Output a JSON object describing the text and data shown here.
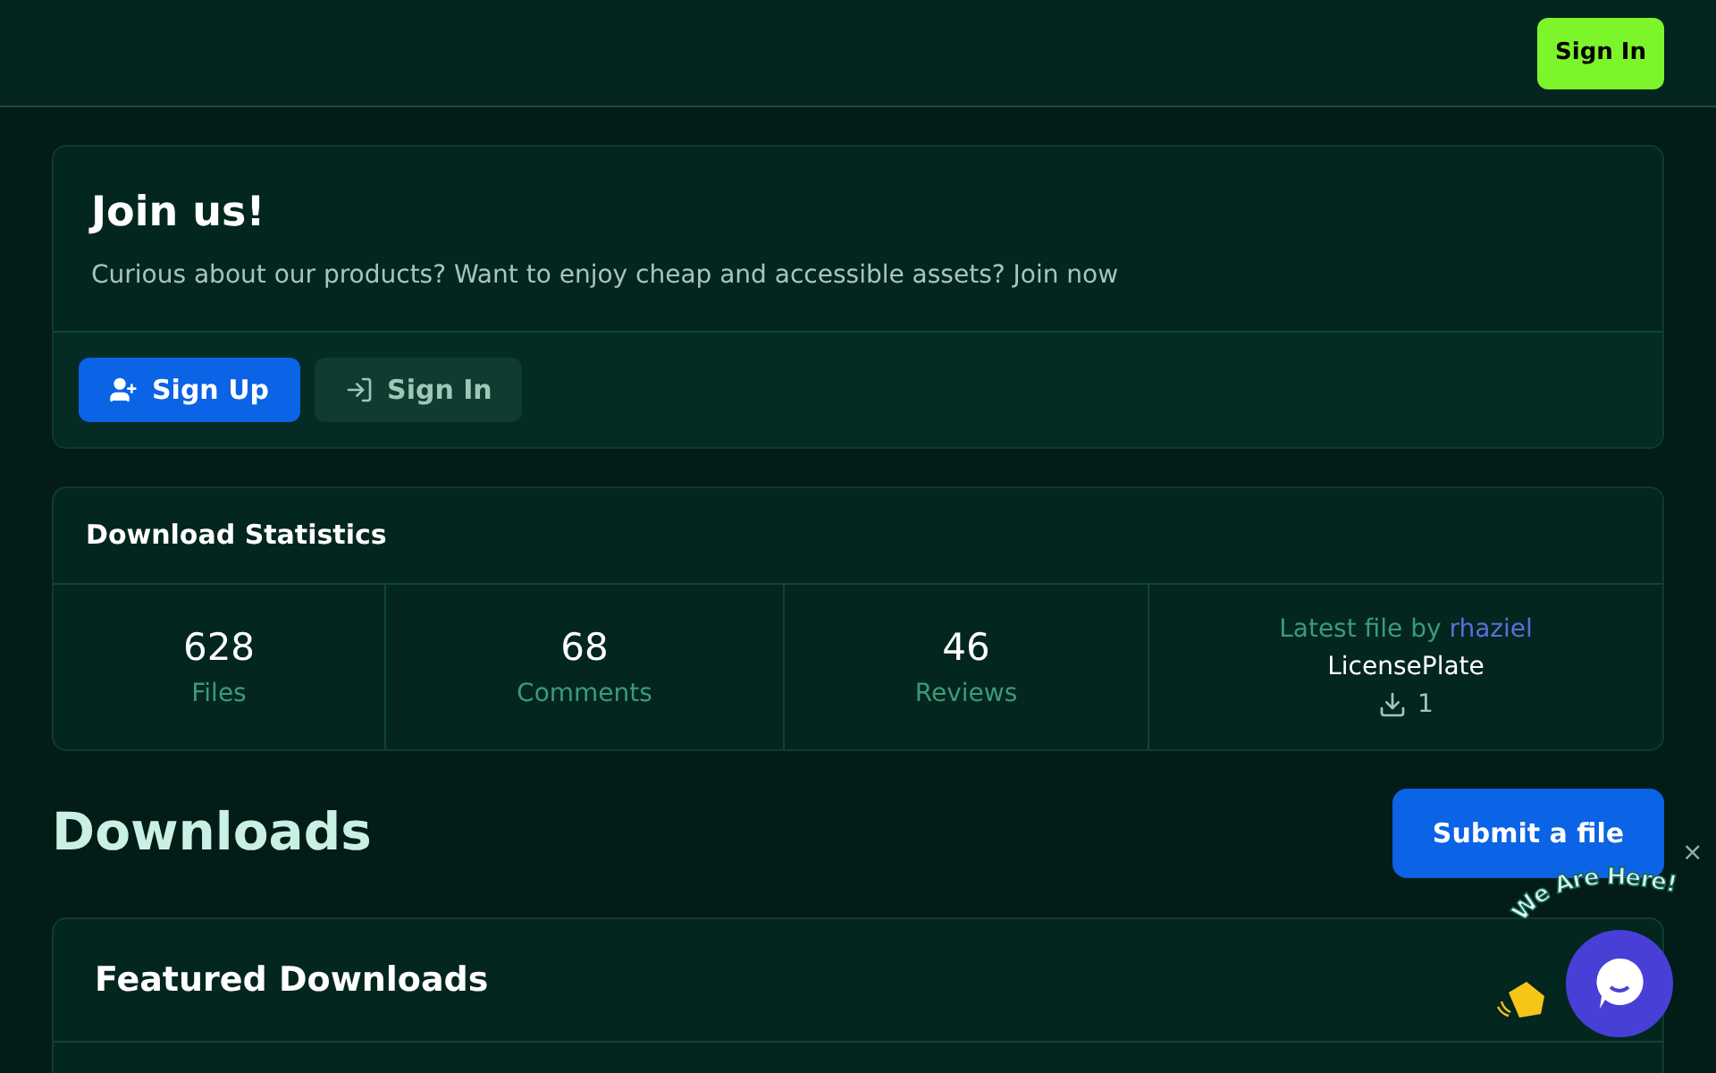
{
  "header": {
    "sign_in": "Sign In"
  },
  "join": {
    "title": "Join us!",
    "text": "Curious about our products? Want to enjoy cheap and accessible assets? Join now",
    "buttons": [
      {
        "kind": "signup",
        "label": "Sign Up"
      },
      {
        "kind": "signin",
        "label": "Sign In"
      }
    ]
  },
  "stats": {
    "title": "Download Statistics",
    "items": [
      {
        "value": "628",
        "label": "Files"
      },
      {
        "value": "68",
        "label": "Comments"
      },
      {
        "value": "46",
        "label": "Reviews"
      }
    ],
    "latest": {
      "prefix": "Latest file by",
      "user": "rhaziel",
      "file": "LicensePlate",
      "downloads": "1"
    }
  },
  "downloads": {
    "title": "Downloads",
    "submit": "Submit a file",
    "featured_title": "Featured Downloads"
  },
  "chat": {
    "greeting": "We Are Here!",
    "close": "×"
  }
}
